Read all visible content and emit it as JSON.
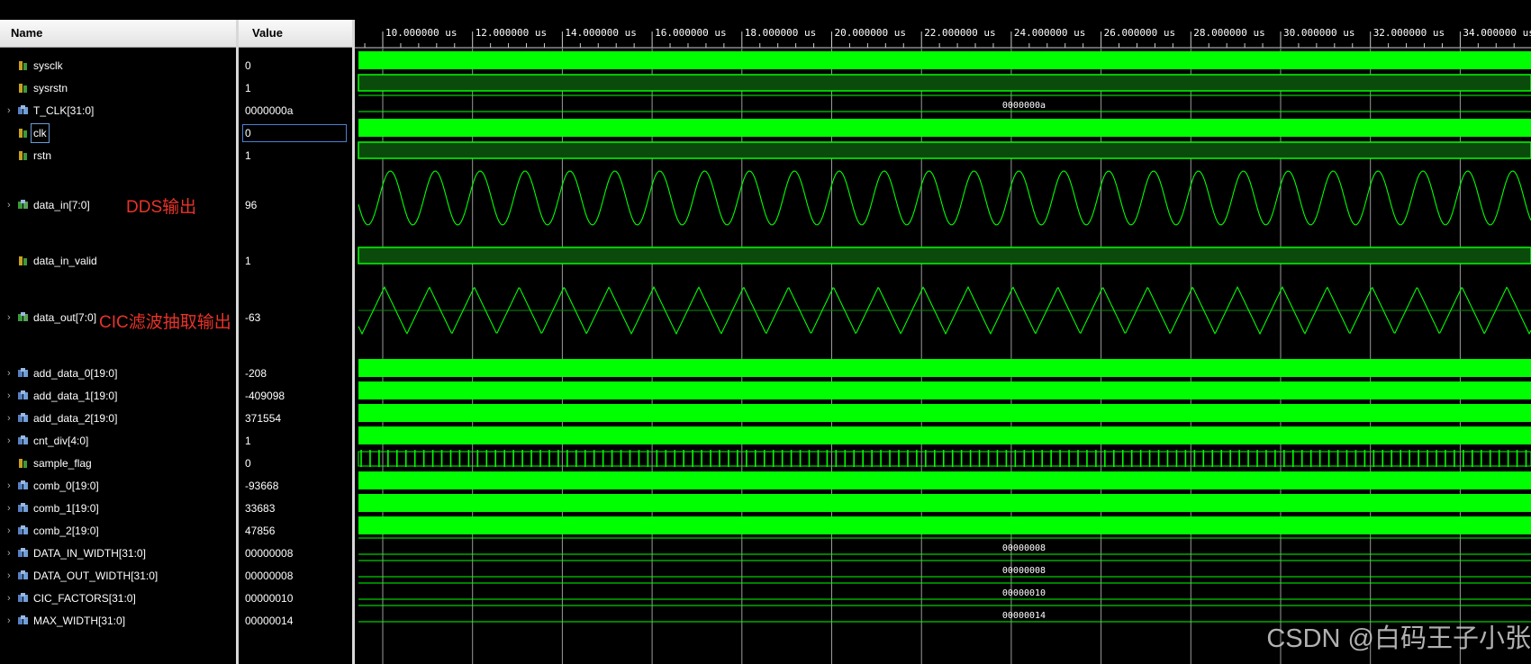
{
  "headers": {
    "name": "Name",
    "value": "Value"
  },
  "time_axis": {
    "unit": "us",
    "ticks": [
      "10.000000 us",
      "12.000000 us",
      "14.000000 us",
      "16.000000 us",
      "18.000000 us",
      "20.000000 us",
      "22.000000 us",
      "24.000000 us",
      "26.000000 us",
      "28.000000 us",
      "30.000000 us",
      "32.000000 us",
      "34.000000 us"
    ]
  },
  "signals": [
    {
      "name": "sysclk",
      "value": "0",
      "icon": "bit-signal-icon",
      "expandable": false,
      "kind": "clock"
    },
    {
      "name": "sysrstn",
      "value": "1",
      "icon": "bit-signal-icon",
      "expandable": false,
      "kind": "high"
    },
    {
      "name": "T_CLK[31:0]",
      "value": "0000000a",
      "icon": "bus-signal-icon",
      "expandable": true,
      "kind": "const",
      "label": "0000000a"
    },
    {
      "name": "clk",
      "value": "0",
      "icon": "bit-signal-icon",
      "expandable": false,
      "kind": "clock",
      "selected": true
    },
    {
      "name": "rstn",
      "value": "1",
      "icon": "bit-signal-icon",
      "expandable": false,
      "kind": "high"
    },
    {
      "name": "data_in[7:0]",
      "value": "96",
      "icon": "analog-bus-icon",
      "expandable": true,
      "kind": "sine"
    },
    {
      "name": "data_in_valid",
      "value": "1",
      "icon": "bit-signal-icon",
      "expandable": false,
      "kind": "high"
    },
    {
      "name": "data_out[7:0]",
      "value": "-63",
      "icon": "analog-bus-icon",
      "expandable": true,
      "kind": "tri"
    },
    {
      "name": "add_data_0[19:0]",
      "value": "-208",
      "icon": "bus-signal-icon",
      "expandable": true,
      "kind": "busy"
    },
    {
      "name": "add_data_1[19:0]",
      "value": "-409098",
      "icon": "bus-signal-icon",
      "expandable": true,
      "kind": "busy"
    },
    {
      "name": "add_data_2[19:0]",
      "value": "371554",
      "icon": "bus-signal-icon",
      "expandable": true,
      "kind": "busy"
    },
    {
      "name": "cnt_div[4:0]",
      "value": "1",
      "icon": "bus-signal-icon",
      "expandable": true,
      "kind": "busy"
    },
    {
      "name": "sample_flag",
      "value": "0",
      "icon": "bit-signal-icon",
      "expandable": false,
      "kind": "pulse"
    },
    {
      "name": "comb_0[19:0]",
      "value": "-93668",
      "icon": "bus-signal-icon",
      "expandable": true,
      "kind": "busy"
    },
    {
      "name": "comb_1[19:0]",
      "value": "33683",
      "icon": "bus-signal-icon",
      "expandable": true,
      "kind": "busy"
    },
    {
      "name": "comb_2[19:0]",
      "value": "47856",
      "icon": "bus-signal-icon",
      "expandable": true,
      "kind": "busy"
    },
    {
      "name": "DATA_IN_WIDTH[31:0]",
      "value": "00000008",
      "icon": "bus-signal-icon",
      "expandable": true,
      "kind": "const",
      "label": "00000008"
    },
    {
      "name": "DATA_OUT_WIDTH[31:0]",
      "value": "00000008",
      "icon": "bus-signal-icon",
      "expandable": true,
      "kind": "const",
      "label": "00000008"
    },
    {
      "name": "CIC_FACTORS[31:0]",
      "value": "00000010",
      "icon": "bus-signal-icon",
      "expandable": true,
      "kind": "const",
      "label": "00000010"
    },
    {
      "name": "MAX_WIDTH[31:0]",
      "value": "00000014",
      "icon": "bus-signal-icon",
      "expandable": true,
      "kind": "const",
      "label": "00000014"
    }
  ],
  "annotations": {
    "dds": "DDS输出",
    "cic": "CIC滤波抽取输出"
  },
  "watermark": "CSDN @白码王子小张",
  "colors": {
    "wave": "#00ff00",
    "wave_dim": "#0a4a0a",
    "grid": "#9a9a9a",
    "annotation": "#e8332a"
  }
}
